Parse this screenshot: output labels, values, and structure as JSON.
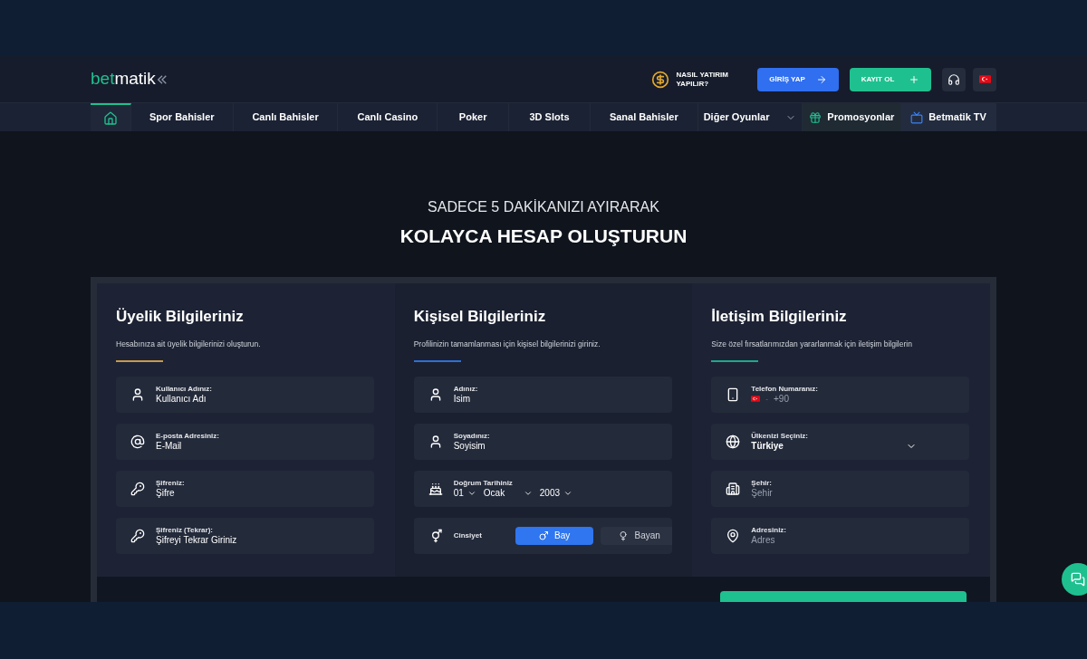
{
  "header": {
    "logo": [
      "bet",
      "matik"
    ],
    "deposit_help": [
      "NASIL YATIRIM",
      "YAPILIR?"
    ],
    "login": "GİRİŞ YAP",
    "register": "KAYIT OL"
  },
  "nav": [
    {
      "kind": "home",
      "selected": true
    },
    {
      "kind": "link",
      "label": "Spor Bahisler",
      "selected": false
    },
    {
      "kind": "link",
      "label": "Canlı Bahisler",
      "selected": false
    },
    {
      "kind": "link",
      "label": "Canlı Casino",
      "selected": false
    },
    {
      "kind": "link",
      "label": "Poker",
      "selected": false
    },
    {
      "kind": "link",
      "label": "3D Slots",
      "selected": false
    },
    {
      "kind": "link",
      "label": "Sanal Bahisler",
      "selected": false
    },
    {
      "kind": "dropdown",
      "label": "Diğer Oyunlar",
      "selected": false
    },
    {
      "kind": "promo",
      "label": "Promosyonlar",
      "selected": false
    },
    {
      "kind": "tv",
      "label": "Betmatik TV",
      "selected": false
    }
  ],
  "hero": {
    "kicker": "SADECE 5 DAKİKANIZI AYIRARAK",
    "title": "KOLAYCA HESAP OLUŞTURUN"
  },
  "sections": [
    {
      "title": "Üyelik Bilgileriniz",
      "subtitle": "Hesabınıza ait üyelik bilgilerinizi oluşturun.",
      "color": "#c79a4a",
      "fields": [
        {
          "kind": "text",
          "label": "Kullanıcı Adınız:",
          "value": "Kullanıcı Adı"
        },
        {
          "kind": "text",
          "label": "E-posta Adresiniz:",
          "value": "E-Mail"
        },
        {
          "kind": "text",
          "label": "Şifreniz:",
          "value": "Şifre"
        },
        {
          "kind": "text",
          "label": "Şifreniz (Tekrar):",
          "value": "Şifreyi Tekrar Giriniz"
        }
      ]
    },
    {
      "title": "Kişisel Bilgileriniz",
      "subtitle": "Profilinizin tamamlanması için kişisel bilgilerinizi giriniz.",
      "color": "#2f6fd6",
      "fields": [
        {
          "kind": "text",
          "label": "Adınız:",
          "value": "Isim"
        },
        {
          "kind": "text",
          "label": "Soyadınız:",
          "value": "Soyisim"
        },
        {
          "kind": "date",
          "label": "Doğrum Tarihiniz",
          "parts": [
            "01",
            "Ocak",
            "2003"
          ]
        },
        {
          "kind": "gender",
          "label": "Cinsiyet",
          "options": [
            {
              "label": "Bay",
              "selected": true
            },
            {
              "label": "Bayan",
              "selected": false
            }
          ]
        }
      ]
    },
    {
      "title": "İletişim Bilgileriniz",
      "subtitle": "Size özel fırsatlarımızdan yararlanmak için iletişim bilgilerin",
      "color": "#1fa88a",
      "fields": [
        {
          "kind": "phone",
          "label": "Telefon Numaranız:",
          "separator": "-",
          "placeholder": "+90"
        },
        {
          "kind": "select",
          "label": "Ülkenizi Seçiniz:",
          "value": "Türkiye"
        },
        {
          "kind": "text",
          "label": "Şehir:",
          "placeholder": "Şehir"
        },
        {
          "kind": "text",
          "label": "Adresiniz:",
          "placeholder": "Adres"
        }
      ]
    }
  ]
}
